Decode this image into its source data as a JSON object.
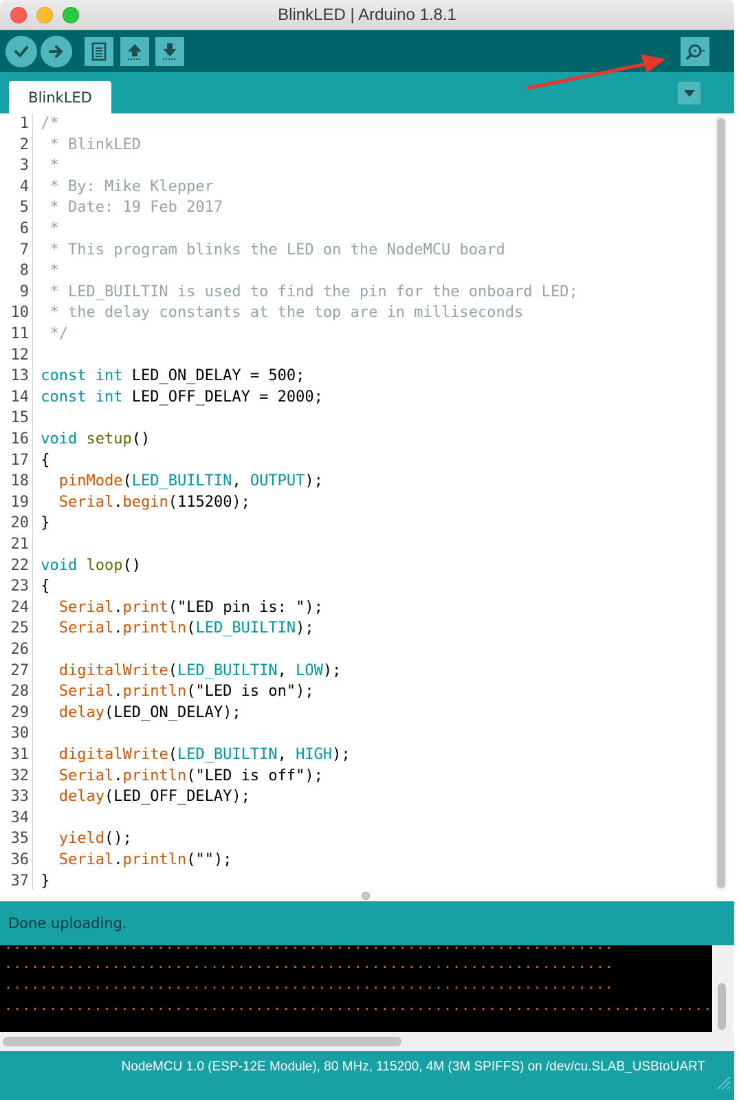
{
  "window": {
    "title": "BlinkLED | Arduino 1.8.1"
  },
  "toolbar": {
    "buttons": [
      {
        "name": "verify",
        "icon": "checkmark-icon"
      },
      {
        "name": "upload",
        "icon": "arrow-right-icon"
      },
      {
        "name": "new",
        "icon": "document-icon"
      },
      {
        "name": "open",
        "icon": "arrow-up-icon"
      },
      {
        "name": "save",
        "icon": "arrow-down-icon"
      },
      {
        "name": "serial-monitor",
        "icon": "magnifier-icon"
      }
    ]
  },
  "tabs": {
    "active": "BlinkLED"
  },
  "editor": {
    "lines": [
      {
        "n": "1",
        "t": "/*"
      },
      {
        "n": "2",
        "t": " * BlinkLED"
      },
      {
        "n": "3",
        "t": " *"
      },
      {
        "n": "4",
        "t": " * By: Mike Klepper"
      },
      {
        "n": "5",
        "t": " * Date: 19 Feb 2017"
      },
      {
        "n": "6",
        "t": " *"
      },
      {
        "n": "7",
        "t": " * This program blinks the LED on the NodeMCU board"
      },
      {
        "n": "8",
        "t": " *"
      },
      {
        "n": "9",
        "t": " * LED_BUILTIN is used to find the pin for the onboard LED;"
      },
      {
        "n": "10",
        "t": " * the delay constants at the top are in milliseconds"
      },
      {
        "n": "11",
        "t": " */"
      },
      {
        "n": "12",
        "t": ""
      },
      {
        "n": "13",
        "t": "const int LED_ON_DELAY = 500;"
      },
      {
        "n": "14",
        "t": "const int LED_OFF_DELAY = 2000;"
      },
      {
        "n": "15",
        "t": ""
      },
      {
        "n": "16",
        "t": "void setup()"
      },
      {
        "n": "17",
        "t": "{"
      },
      {
        "n": "18",
        "t": "  pinMode(LED_BUILTIN, OUTPUT);"
      },
      {
        "n": "19",
        "t": "  Serial.begin(115200);"
      },
      {
        "n": "20",
        "t": "}"
      },
      {
        "n": "21",
        "t": ""
      },
      {
        "n": "22",
        "t": "void loop()"
      },
      {
        "n": "23",
        "t": "{"
      },
      {
        "n": "24",
        "t": "  Serial.print(\"LED pin is: \");"
      },
      {
        "n": "25",
        "t": "  Serial.println(LED_BUILTIN);"
      },
      {
        "n": "26",
        "t": ""
      },
      {
        "n": "27",
        "t": "  digitalWrite(LED_BUILTIN, LOW);"
      },
      {
        "n": "28",
        "t": "  Serial.println(\"LED is on\");"
      },
      {
        "n": "29",
        "t": "  delay(LED_ON_DELAY);"
      },
      {
        "n": "30",
        "t": ""
      },
      {
        "n": "31",
        "t": "  digitalWrite(LED_BUILTIN, HIGH);"
      },
      {
        "n": "32",
        "t": "  Serial.println(\"LED is off\");"
      },
      {
        "n": "33",
        "t": "  delay(LED_OFF_DELAY);"
      },
      {
        "n": "34",
        "t": ""
      },
      {
        "n": "35",
        "t": "  yield();"
      },
      {
        "n": "36",
        "t": "  Serial.println(\"\");"
      },
      {
        "n": "37",
        "t": "}"
      }
    ]
  },
  "status": {
    "message": "Done uploading."
  },
  "console": {
    "lines": [
      "....................................................................",
      "....................................................................",
      "................................................................................................................................................................"
    ]
  },
  "footer": {
    "board_info": "NodeMCU 1.0 (ESP-12E Module), 80 MHz, 115200, 4M (3M SPIFFS) on /dev/cu.SLAB_USBtoUART"
  },
  "colors": {
    "toolbar_bg": "#006468",
    "tabrow_bg": "#17a1a5",
    "button_bg": "#4db7bb",
    "comment": "#95a5a6",
    "keyword": "#00979c",
    "function": "#d35400",
    "annotation_arrow": "#e8362a"
  }
}
